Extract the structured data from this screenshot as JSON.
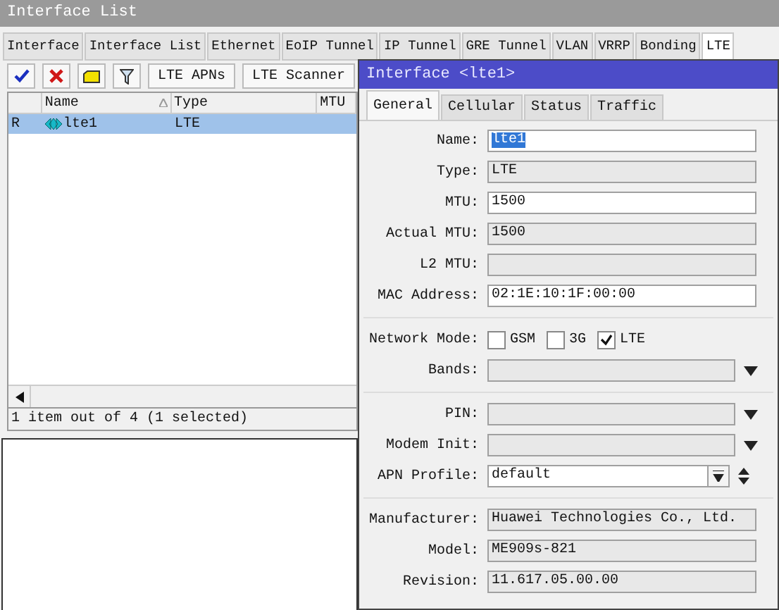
{
  "window": {
    "title": "Interface List"
  },
  "tabs": [
    {
      "label": "Interface",
      "selected": false
    },
    {
      "label": "Interface List",
      "selected": false
    },
    {
      "label": "Ethernet",
      "selected": false
    },
    {
      "label": "EoIP Tunnel",
      "selected": false
    },
    {
      "label": "IP Tunnel",
      "selected": false
    },
    {
      "label": "GRE Tunnel",
      "selected": false
    },
    {
      "label": "VLAN",
      "selected": false
    },
    {
      "label": "VRRP",
      "selected": false
    },
    {
      "label": "Bonding",
      "selected": false
    },
    {
      "label": "LTE",
      "selected": true
    }
  ],
  "toolbar": {
    "buttons": [
      "LTE APNs",
      "LTE Scanner"
    ]
  },
  "table": {
    "columns": [
      {
        "sorted": false
      },
      {
        "label": "Name",
        "sorted": true
      },
      {
        "label": "Type",
        "sorted": false
      },
      {
        "label": "MTU",
        "sorted": false
      }
    ],
    "rows": [
      {
        "flag": "R",
        "name": "lte1",
        "type": "LTE",
        "selected": true
      }
    ]
  },
  "status_bar": "1 item out of 4 (1 selected)",
  "dialog": {
    "title": "Interface <lte1>",
    "tabs": [
      {
        "label": "General",
        "selected": true
      },
      {
        "label": "Cellular",
        "selected": false
      },
      {
        "label": "Status",
        "selected": false
      },
      {
        "label": "Traffic",
        "selected": false
      }
    ],
    "groups": [
      [
        {
          "kind": "input",
          "label": "Name:",
          "value": "lte1",
          "selected": true
        },
        {
          "kind": "readonly",
          "label": "Type:",
          "value": "LTE"
        },
        {
          "kind": "input",
          "label": "MTU:",
          "value": "1500"
        },
        {
          "kind": "readonly",
          "label": "Actual MTU:",
          "value": "1500"
        },
        {
          "kind": "readonly",
          "label": "L2 MTU:"
        },
        {
          "kind": "input",
          "label": "MAC Address:",
          "value": "02:1E:10:1F:00:00"
        }
      ],
      [
        {
          "kind": "checks",
          "label": "Network Mode:",
          "options": [
            {
              "label": "GSM",
              "checked": false
            },
            {
              "label": "3G",
              "checked": false
            },
            {
              "label": "LTE",
              "checked": true
            }
          ]
        },
        {
          "kind": "dropdown",
          "label": "Bands:"
        }
      ],
      [
        {
          "kind": "dropdown",
          "label": "PIN:"
        },
        {
          "kind": "dropdown",
          "label": "Modem Init:"
        },
        {
          "kind": "select",
          "label": "APN Profile:",
          "value": "default"
        }
      ],
      [
        {
          "kind": "readonly",
          "label": "Manufacturer:",
          "value": "Huawei Technologies Co., Ltd."
        },
        {
          "kind": "readonly",
          "label": "Model:",
          "value": "ME909s-821"
        },
        {
          "kind": "readonly",
          "label": "Revision:",
          "value": "11.617.05.00.00"
        }
      ]
    ]
  }
}
